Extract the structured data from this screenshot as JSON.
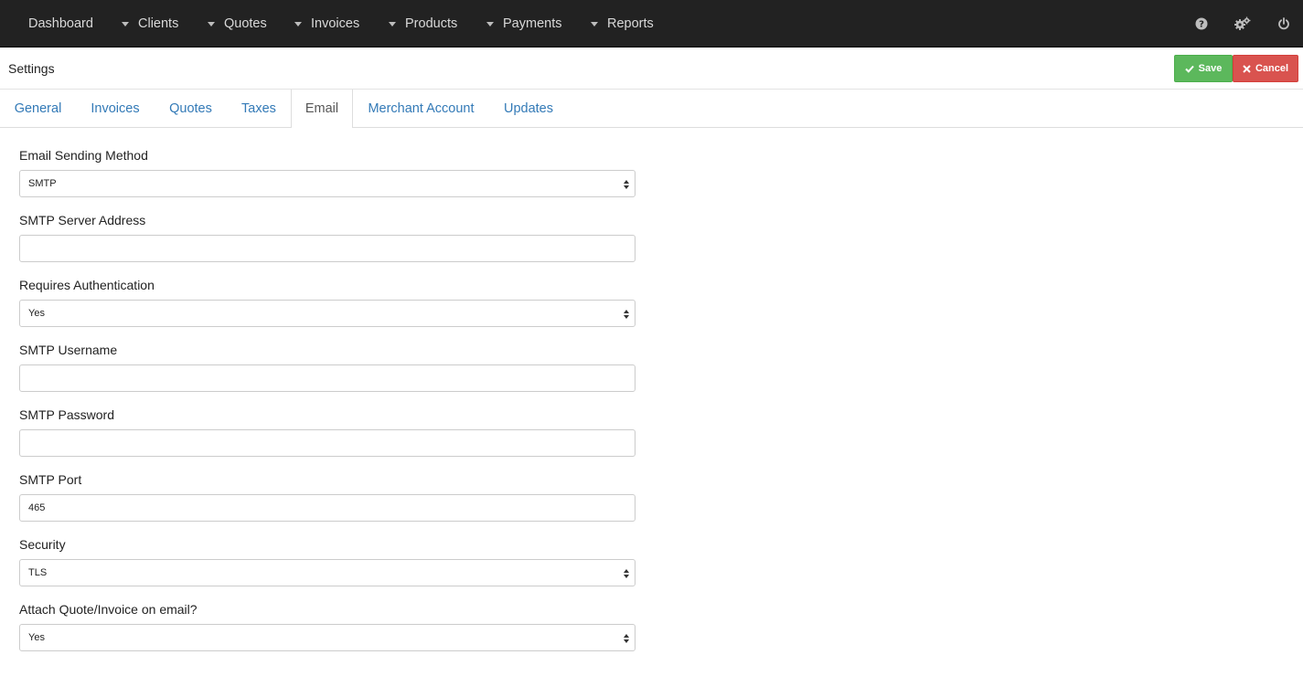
{
  "nav": {
    "items": [
      {
        "label": "Dashboard",
        "dropdown": false
      },
      {
        "label": "Clients",
        "dropdown": true
      },
      {
        "label": "Quotes",
        "dropdown": true
      },
      {
        "label": "Invoices",
        "dropdown": true
      },
      {
        "label": "Products",
        "dropdown": true
      },
      {
        "label": "Payments",
        "dropdown": true
      },
      {
        "label": "Reports",
        "dropdown": true
      }
    ],
    "icons": [
      "question-circle-icon",
      "gears-icon",
      "power-off-icon"
    ]
  },
  "header": {
    "title": "Settings",
    "save_label": "Save",
    "cancel_label": "Cancel"
  },
  "tabs": [
    {
      "label": "General",
      "active": false
    },
    {
      "label": "Invoices",
      "active": false
    },
    {
      "label": "Quotes",
      "active": false
    },
    {
      "label": "Taxes",
      "active": false
    },
    {
      "label": "Email",
      "active": true
    },
    {
      "label": "Merchant Account",
      "active": false
    },
    {
      "label": "Updates",
      "active": false
    }
  ],
  "form": {
    "email_sending_method": {
      "label": "Email Sending Method",
      "value": "SMTP"
    },
    "smtp_server_address": {
      "label": "SMTP Server Address",
      "value": ""
    },
    "requires_authentication": {
      "label": "Requires Authentication",
      "value": "Yes"
    },
    "smtp_username": {
      "label": "SMTP Username",
      "value": ""
    },
    "smtp_password": {
      "label": "SMTP Password",
      "value": ""
    },
    "smtp_port": {
      "label": "SMTP Port",
      "value": "465"
    },
    "security": {
      "label": "Security",
      "value": "TLS"
    },
    "attach_document": {
      "label": "Attach Quote/Invoice on email?",
      "value": "Yes"
    }
  },
  "colors": {
    "navbar_bg": "#222222",
    "link": "#337ab7",
    "save": "#5cb85c",
    "cancel": "#d9534f"
  }
}
